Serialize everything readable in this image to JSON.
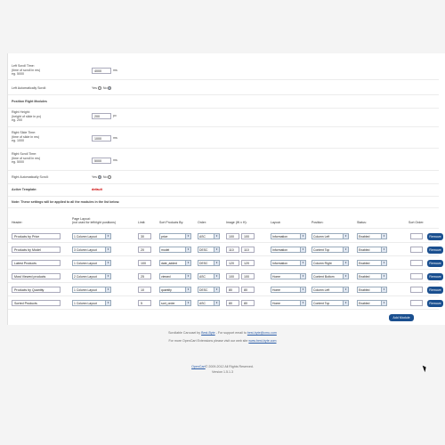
{
  "settings": {
    "left_scroll_time": {
      "label_lines": [
        "Left Scroll Time:",
        "(time of scroll in ms)",
        "eg. 5000"
      ],
      "value": "4000",
      "unit": "ms"
    },
    "left_auto_scroll": {
      "label": "Left Automatically Scroll:",
      "yes": "Yes",
      "no": "No",
      "selected": "no"
    },
    "position_right_title": "Position Right Modules",
    "right_height": {
      "label_lines": [
        "Right Height:",
        "(height of slide in px)",
        "eg. 200"
      ],
      "value": "200",
      "unit": "px"
    },
    "right_slide_time": {
      "label_lines": [
        "Right Slide Time:",
        "(time of slide in ms)",
        "eg. 1000"
      ],
      "value": "1000",
      "unit": "ms"
    },
    "right_scroll_time": {
      "label_lines": [
        "Right Scroll Time:",
        "(time of scroll in ms)",
        "eg. 5000"
      ],
      "value": "5000",
      "unit": "ms"
    },
    "right_auto_scroll": {
      "label": "Right Automatically Scroll:",
      "yes": "Yes",
      "no": "No",
      "selected": "yes"
    },
    "active_template": {
      "label": "Active Template:",
      "value": "default"
    },
    "note": "Note: These settings will be applied to all the modules in the list below."
  },
  "table": {
    "headers": {
      "header": "Header:",
      "layout": "Page Layout:",
      "layout_note": "(not used for left/right positions)",
      "limit": "Limit:",
      "sort": "Sort Products By:",
      "order": "Order:",
      "image": "Image (W x H):",
      "layout2": "Layout:",
      "position": "Position:",
      "status": "Status:",
      "sort_order": "Sort Order:"
    },
    "rows": [
      {
        "header": "Products by Price",
        "page_layout": "1 Column Layout",
        "limit": "30",
        "sort": "price",
        "order": "ASC",
        "img_w": "100",
        "img_h": "100",
        "layout": "Information",
        "position": "Column Left",
        "status": "Enabled",
        "sort_order": "",
        "remove": "Remove"
      },
      {
        "header": "Products by Model",
        "page_layout": "3 Column Layout",
        "limit": "20",
        "sort": "model",
        "order": "DESC",
        "img_w": "110",
        "img_h": "110",
        "layout": "Information",
        "position": "Content Top",
        "status": "Enabled",
        "sort_order": "",
        "remove": "Remove"
      },
      {
        "header": "Latest Products",
        "page_layout": "1 Column Layout",
        "limit": "100",
        "sort": "date_added",
        "order": "DESC",
        "img_w": "120",
        "img_h": "120",
        "layout": "Information",
        "position": "Column Right",
        "status": "Enabled",
        "sort_order": "",
        "remove": "Remove"
      },
      {
        "header": "Most Viewed products",
        "page_layout": "2 Column Layout",
        "limit": "25",
        "sort": "viewed",
        "order": "ASC",
        "img_w": "100",
        "img_h": "100",
        "layout": "Home",
        "position": "Content Bottom",
        "status": "Enabled",
        "sort_order": "",
        "remove": "Remove"
      },
      {
        "header": "Products by Quantity",
        "page_layout": "1 Column Layout",
        "limit": "10",
        "sort": "quantity",
        "order": "DESC",
        "img_w": "80",
        "img_h": "80",
        "layout": "Home",
        "position": "Column Left",
        "status": "Enabled",
        "sort_order": "",
        "remove": "Remove"
      },
      {
        "header": "Sorted Products",
        "page_layout": "1 Column Layout",
        "limit": "5",
        "sort": "sort_order",
        "order": "ASC",
        "img_w": "80",
        "img_h": "80",
        "layout": "Home",
        "position": "Content Top",
        "status": "Enabled",
        "sort_order": "",
        "remove": "Remove"
      }
    ],
    "add_module": "Add Module"
  },
  "footer": {
    "line1_prefix": "Scrollable Carousel by",
    "line1_link": "Best-Byte",
    "line1_mid": "- For support email to",
    "line1_email": "best-byte@cmu.com",
    "line2_prefix": "For more OpenCart Extensions please visit our web site",
    "line2_link": "www.best-byte.com",
    "copyright_link": "OpenCart",
    "copyright_text": "© 2009-2012 All Rights Reserved.",
    "version": "Version 1.5.1.3"
  },
  "colors": {
    "button": "#1a4f8f",
    "active_template": "#cc0000",
    "link": "#2a5ca8"
  }
}
